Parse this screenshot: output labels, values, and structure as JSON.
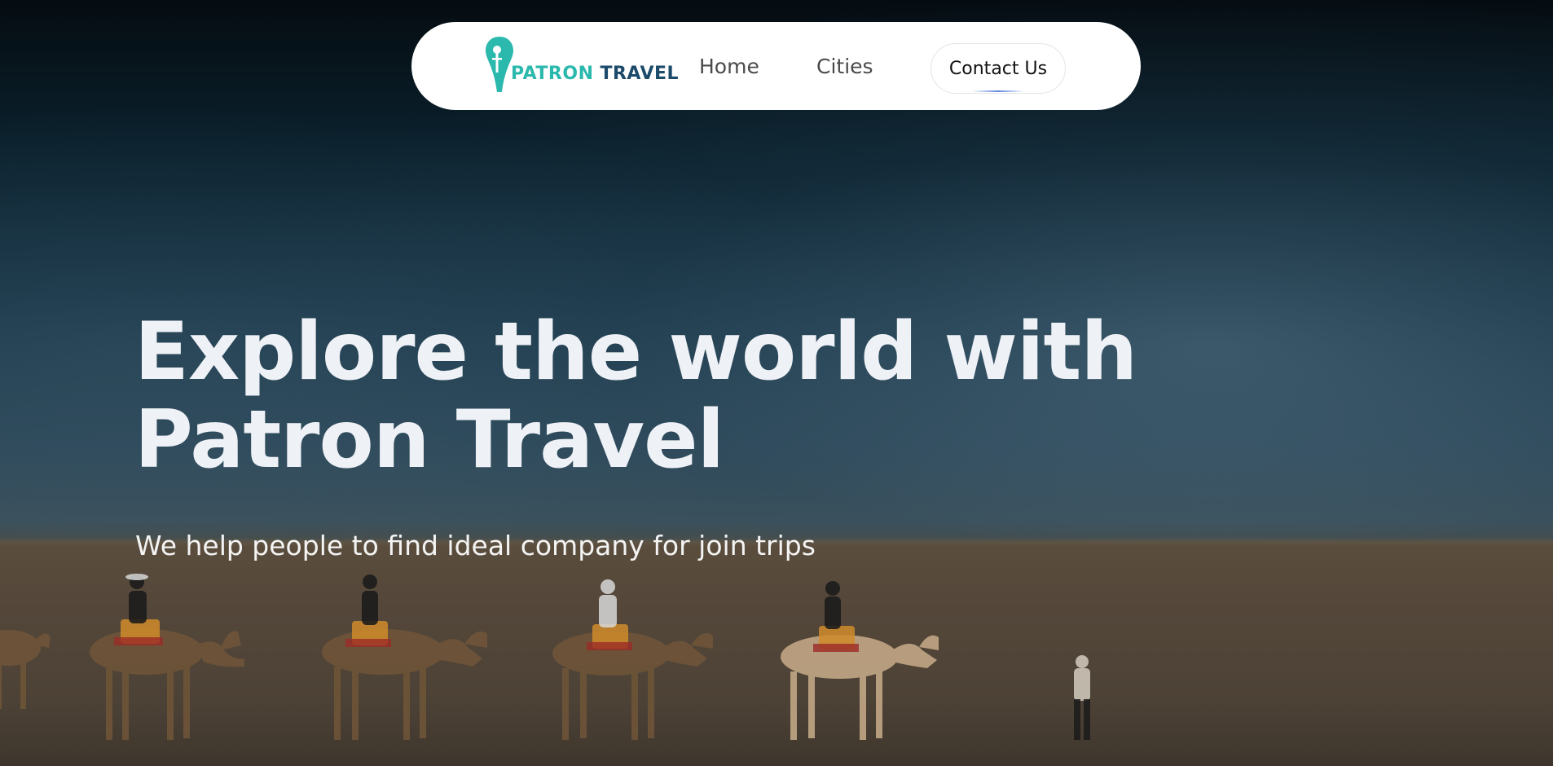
{
  "brand": {
    "word1": "PATRON",
    "word2": "TRAVEL",
    "color_primary": "#2bb8ad",
    "color_secondary": "#1b4a6b"
  },
  "nav": {
    "links": [
      {
        "label": "Home"
      },
      {
        "label": "Cities"
      }
    ],
    "contact_label": "Contact Us"
  },
  "hero": {
    "headline_line1": "Explore the world with",
    "headline_line2": "Patron Travel",
    "subheadline": "We help people to find ideal company for join trips"
  },
  "icons": {
    "logo": "map-pin-icon"
  }
}
